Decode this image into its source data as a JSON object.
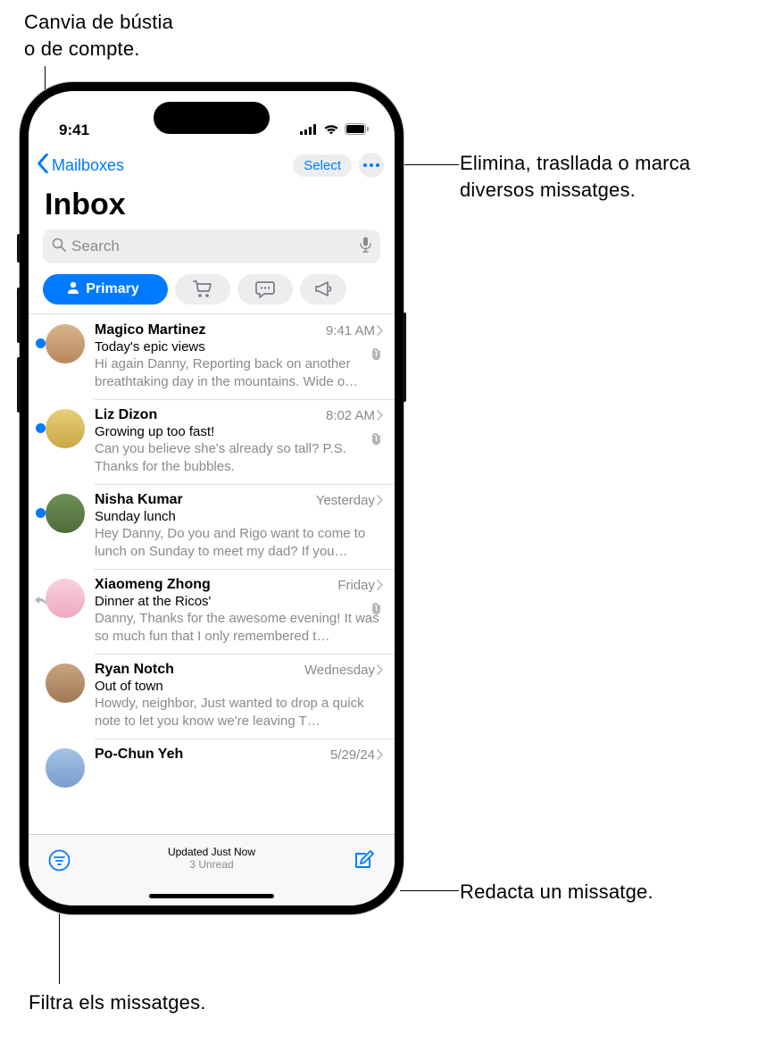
{
  "callouts": {
    "top_left": "Canvia de bústia\no de compte.",
    "top_right": "Elimina, trasllada o marca\ndiversos missatges.",
    "bottom_right": "Redacta un missatge.",
    "bottom_left": "Filtra els missatges."
  },
  "status": {
    "time": "9:41"
  },
  "nav": {
    "back_label": "Mailboxes",
    "select_label": "Select"
  },
  "title": "Inbox",
  "search": {
    "placeholder": "Search"
  },
  "categories": {
    "primary_label": "Primary"
  },
  "messages": [
    {
      "sender": "Magico Martinez",
      "date": "9:41 AM",
      "subject": "Today's epic views",
      "preview": "Hi again Danny, Reporting back on another breathtaking day in the mountains. Wide o…",
      "unread": true,
      "attachment": true,
      "avatar": "#c79a6b"
    },
    {
      "sender": "Liz Dizon",
      "date": "8:02 AM",
      "subject": "Growing up too fast!",
      "preview": "Can you believe she's already so tall? P.S. Thanks for the bubbles.",
      "unread": true,
      "attachment": true,
      "avatar": "#d8b56a"
    },
    {
      "sender": "Nisha Kumar",
      "date": "Yesterday",
      "subject": "Sunday lunch",
      "preview": "Hey Danny, Do you and Rigo want to come to lunch on Sunday to meet my dad? If you…",
      "unread": true,
      "attachment": false,
      "avatar": "#5a7a4a"
    },
    {
      "sender": "Xiaomeng Zhong",
      "date": "Friday",
      "subject": "Dinner at the Ricos'",
      "preview": "Danny, Thanks for the awesome evening! It was so much fun that I only remembered t…",
      "unread": false,
      "replied": true,
      "attachment": true,
      "avatar": "#f5b6c8"
    },
    {
      "sender": "Ryan Notch",
      "date": "Wednesday",
      "subject": "Out of town",
      "preview": "Howdy, neighbor, Just wanted to drop a quick note to let you know we're leaving T…",
      "unread": false,
      "attachment": false,
      "avatar": "#b28a6f"
    },
    {
      "sender": "Po-Chun Yeh",
      "date": "5/29/24",
      "subject": "",
      "preview": "",
      "unread": false,
      "attachment": false,
      "avatar": "#8bb0e0"
    }
  ],
  "toolbar": {
    "line1": "Updated Just Now",
    "line2": "3 Unread"
  }
}
